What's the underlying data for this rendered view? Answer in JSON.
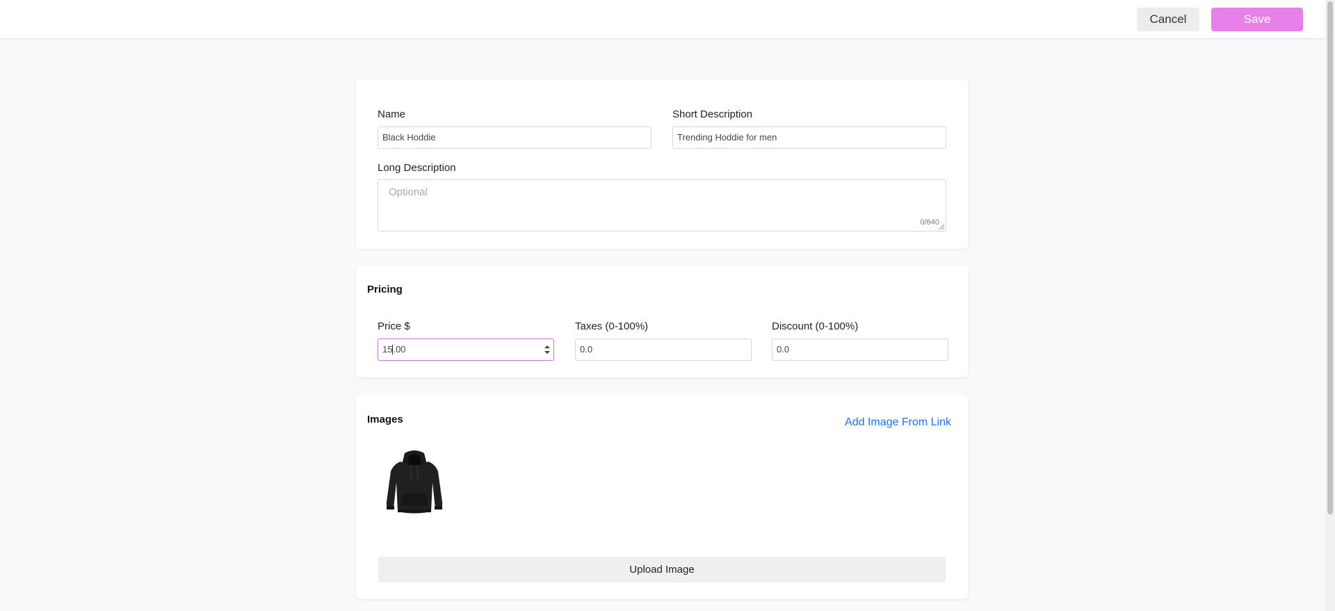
{
  "header": {
    "cancel_label": "Cancel",
    "save_label": "Save"
  },
  "details": {
    "name_label": "Name",
    "name_value": "Black Hoddie",
    "short_desc_label": "Short Description",
    "short_desc_value": "Trending Hoddie for men",
    "long_desc_label": "Long Description",
    "long_desc_placeholder": "Optional",
    "long_desc_counter": "0/640"
  },
  "pricing": {
    "title": "Pricing",
    "price_label": "Price $",
    "price_value_before_caret": "15",
    "price_value_after_caret": ".00",
    "taxes_label": "Taxes (0-100%)",
    "taxes_value": "0.0",
    "discount_label": "Discount (0-100%)",
    "discount_value": "0.0"
  },
  "images": {
    "title": "Images",
    "add_link_label": "Add Image From Link",
    "upload_label": "Upload Image",
    "items": [
      {
        "icon": "hoodie-image"
      }
    ]
  },
  "colors": {
    "accent": "#e780e8",
    "focus_border": "#d06ad6",
    "link": "#1a73e8"
  }
}
